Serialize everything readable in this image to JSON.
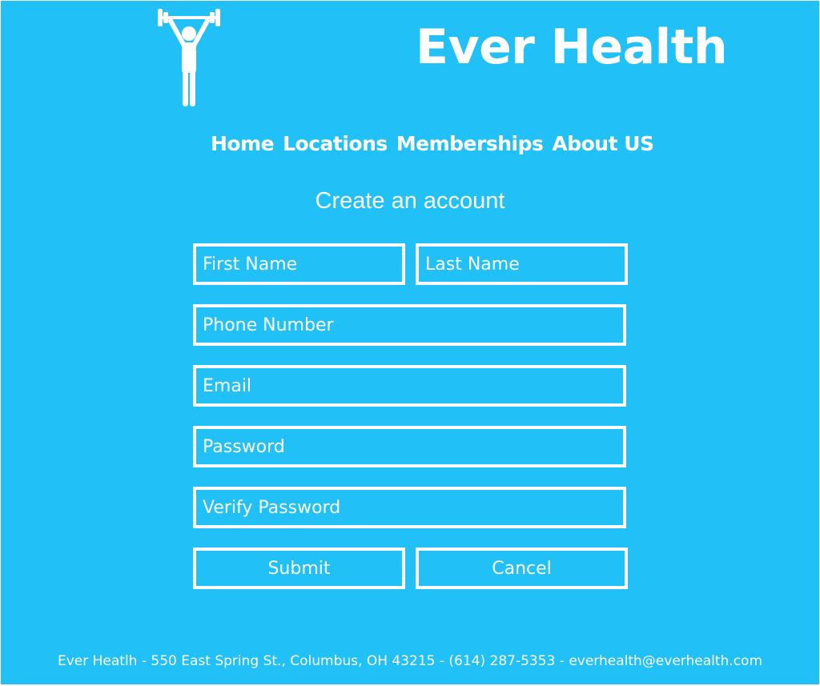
{
  "header": {
    "logo_icon": "weightlifter-icon",
    "brand": "Ever Health"
  },
  "nav": {
    "items": [
      {
        "label": "Home"
      },
      {
        "label": "Locations"
      },
      {
        "label": "Memberships"
      },
      {
        "label": "About US"
      }
    ]
  },
  "form": {
    "title": "Create an account",
    "first_name": {
      "placeholder": "First Name",
      "value": ""
    },
    "last_name": {
      "placeholder": "Last Name",
      "value": ""
    },
    "phone": {
      "placeholder": "Phone Number",
      "value": ""
    },
    "email": {
      "placeholder": "Email",
      "value": ""
    },
    "password": {
      "placeholder": "Password",
      "value": ""
    },
    "verify_password": {
      "placeholder": "Verify Password",
      "value": ""
    },
    "submit_label": "Submit",
    "cancel_label": "Cancel"
  },
  "footer": {
    "text": "Ever Heatlh - 550 East Spring St., Columbus, OH 43215 - (614) 287-5353 - everhealth@everhealth.com"
  },
  "colors": {
    "background": "#21c1f7",
    "foreground": "#ffffff"
  }
}
